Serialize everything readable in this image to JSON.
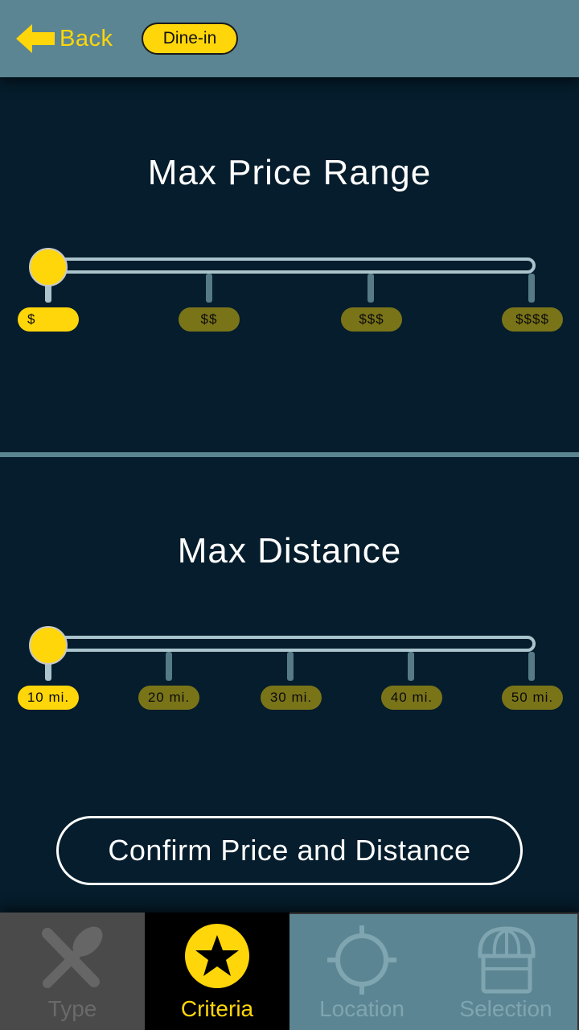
{
  "header": {
    "back_label": "Back",
    "mode_tag": "Dine-in"
  },
  "price": {
    "title": "Max Price Range",
    "options": [
      "$",
      "$$",
      "$$$",
      "$$$$"
    ],
    "selected_index": 0
  },
  "distance": {
    "title": "Max Distance",
    "options": [
      "10 mi.",
      "20 mi.",
      "30 mi.",
      "40 mi.",
      "50 mi."
    ],
    "selected_index": 0
  },
  "confirm_label": "Confirm Price and Distance",
  "nav": {
    "items": [
      {
        "label": "Type",
        "icon": "utensils-icon",
        "state": "disabled"
      },
      {
        "label": "Criteria",
        "icon": "star-icon",
        "state": "active"
      },
      {
        "label": "Location",
        "icon": "crosshair-icon",
        "state": "inactive"
      },
      {
        "label": "Selection",
        "icon": "storefront-icon",
        "state": "inactive"
      }
    ]
  },
  "colors": {
    "accent": "#ffd60a",
    "background": "#051d2c",
    "header": "#5b8592",
    "tick_inactive": "#7a7419"
  }
}
